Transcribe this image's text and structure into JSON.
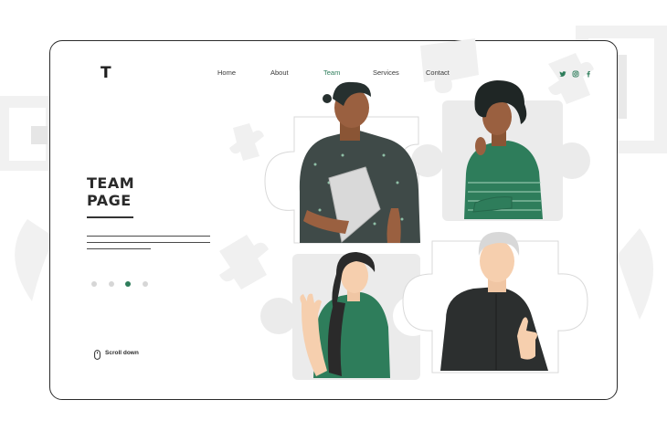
{
  "logo": "T",
  "nav": {
    "items": [
      {
        "label": "Home",
        "active": false
      },
      {
        "label": "About",
        "active": false
      },
      {
        "label": "Team",
        "active": true
      },
      {
        "label": "Services",
        "active": false
      },
      {
        "label": "Contact",
        "active": false
      }
    ]
  },
  "social": [
    "twitter-icon",
    "instagram-icon",
    "facebook-icon"
  ],
  "hero": {
    "title_line1": "TEAM",
    "title_line2": "PAGE"
  },
  "pagination": {
    "total": 4,
    "active_index": 2
  },
  "scroll_label": "Scroll down",
  "colors": {
    "accent": "#2e7d5b",
    "text": "#2a2a2a",
    "puzzle": "#ebebeb"
  }
}
